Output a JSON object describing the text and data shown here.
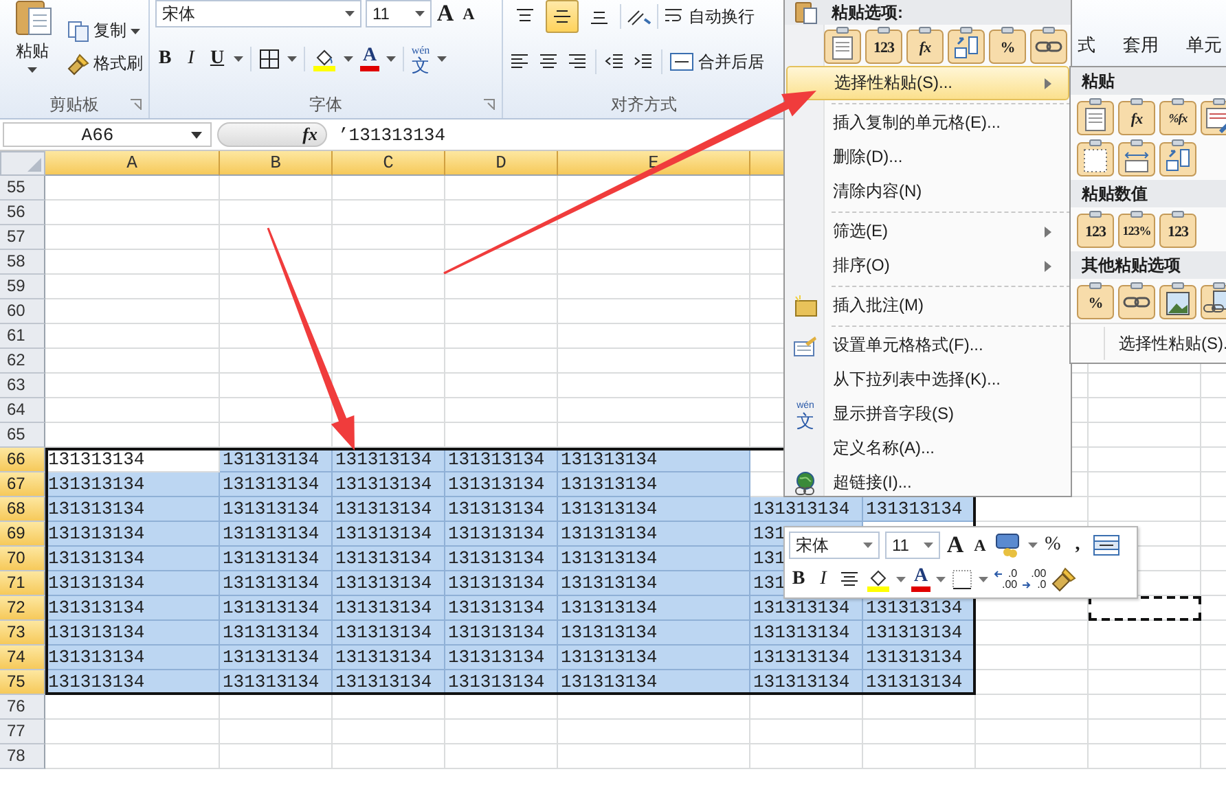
{
  "ribbon": {
    "clipboard": {
      "paste": "粘贴",
      "copy": "复制",
      "format_painter": "格式刷",
      "label": "剪贴板"
    },
    "font": {
      "name": "宋体",
      "size": "11",
      "grow": "A",
      "shrink": "A",
      "styles": [
        {
          "kind": "bold",
          "text": "B"
        },
        {
          "kind": "italic",
          "text": "I"
        },
        {
          "kind": "underline",
          "text": "U"
        }
      ],
      "font_color": "A",
      "phonetic_top": "wén",
      "phonetic_bottom": "文",
      "label": "字体"
    },
    "alignment": {
      "vertical": [
        {
          "kind": "top",
          "selected": false
        },
        {
          "kind": "middle",
          "selected": true
        },
        {
          "kind": "bottom",
          "selected": false
        }
      ],
      "wrap": "自动换行",
      "merge": "合并后居",
      "label": "对齐方式"
    },
    "styles": [
      "式",
      "套用",
      "单元"
    ]
  },
  "formula_bar": {
    "name_box": "A66",
    "fx": "fx",
    "value": "’131313134"
  },
  "sheet": {
    "columns": [
      {
        "label": "A",
        "selected": true
      },
      {
        "label": "B",
        "selected": true
      },
      {
        "label": "C",
        "selected": true
      },
      {
        "label": "D",
        "selected": true
      },
      {
        "label": "E",
        "selected": true
      },
      {
        "selected": true
      }
    ],
    "rows": [
      {
        "number": "55",
        "selected": false
      },
      {
        "number": "56",
        "selected": false
      },
      {
        "number": "57",
        "selected": false
      },
      {
        "number": "58",
        "selected": false
      },
      {
        "number": "59",
        "selected": false
      },
      {
        "number": "60",
        "selected": false
      },
      {
        "number": "61",
        "selected": false
      },
      {
        "number": "62",
        "selected": false
      },
      {
        "number": "63",
        "selected": false
      },
      {
        "number": "64",
        "selected": false
      },
      {
        "number": "65",
        "selected": false
      },
      {
        "number": "66",
        "selected": true,
        "cells": [
          {
            "text": "131313134",
            "selected": false
          },
          {
            "text": "131313134",
            "selected": true
          },
          {
            "text": "131313134",
            "selected": true
          },
          {
            "text": "131313134",
            "selected": true
          },
          {
            "text": "131313134",
            "selected": true
          }
        ]
      },
      {
        "number": "67",
        "selected": true,
        "cells": [
          {
            "text": "131313134",
            "selected": true
          },
          {
            "text": "131313134",
            "selected": true
          },
          {
            "text": "131313134",
            "selected": true
          },
          {
            "text": "131313134",
            "selected": true
          },
          {
            "text": "131313134",
            "selected": true
          }
        ]
      },
      {
        "number": "68",
        "selected": true,
        "cells": [
          {
            "text": "131313134",
            "selected": true
          },
          {
            "text": "131313134",
            "selected": true
          },
          {
            "text": "131313134",
            "selected": true
          },
          {
            "text": "131313134",
            "selected": true
          },
          {
            "text": "131313134",
            "selected": true
          },
          {
            "text": "131313134",
            "selected": true
          },
          {
            "text": "131313134",
            "selected": true
          }
        ]
      },
      {
        "number": "69",
        "selected": true,
        "cells": [
          {
            "text": "131313134",
            "selected": true
          },
          {
            "text": "131313134",
            "selected": true
          },
          {
            "text": "131313134",
            "selected": true
          },
          {
            "text": "131313134",
            "selected": true
          },
          {
            "text": "131313134",
            "selected": true
          },
          {
            "text": "131",
            "selected": true
          }
        ]
      },
      {
        "number": "70",
        "selected": true,
        "cells": [
          {
            "text": "131313134",
            "selected": true
          },
          {
            "text": "131313134",
            "selected": true
          },
          {
            "text": "131313134",
            "selected": true
          },
          {
            "text": "131313134",
            "selected": true
          },
          {
            "text": "131313134",
            "selected": true
          },
          {
            "text": "131",
            "selected": true
          }
        ]
      },
      {
        "number": "71",
        "selected": true,
        "cells": [
          {
            "text": "131313134",
            "selected": true
          },
          {
            "text": "131313134",
            "selected": true
          },
          {
            "text": "131313134",
            "selected": true
          },
          {
            "text": "131313134",
            "selected": true
          },
          {
            "text": "131313134",
            "selected": true
          },
          {
            "text": "131",
            "selected": true
          }
        ]
      },
      {
        "number": "72",
        "selected": true,
        "cells": [
          {
            "text": "131313134",
            "selected": true
          },
          {
            "text": "131313134",
            "selected": true
          },
          {
            "text": "131313134",
            "selected": true
          },
          {
            "text": "131313134",
            "selected": true
          },
          {
            "text": "131313134",
            "selected": true
          },
          {
            "text": "131313134",
            "selected": true
          },
          {
            "text": "131313134",
            "selected": true
          }
        ]
      },
      {
        "number": "73",
        "selected": true,
        "cells": [
          {
            "text": "131313134",
            "selected": true
          },
          {
            "text": "131313134",
            "selected": true
          },
          {
            "text": "131313134",
            "selected": true
          },
          {
            "text": "131313134",
            "selected": true
          },
          {
            "text": "131313134",
            "selected": true
          },
          {
            "text": "131313134",
            "selected": true
          },
          {
            "text": "131313134",
            "selected": true
          }
        ]
      },
      {
        "number": "74",
        "selected": true,
        "cells": [
          {
            "text": "131313134",
            "selected": true
          },
          {
            "text": "131313134",
            "selected": true
          },
          {
            "text": "131313134",
            "selected": true
          },
          {
            "text": "131313134",
            "selected": true
          },
          {
            "text": "131313134",
            "selected": true
          },
          {
            "text": "131313134",
            "selected": true
          },
          {
            "text": "131313134",
            "selected": true
          }
        ]
      },
      {
        "number": "75",
        "selected": true,
        "cells": [
          {
            "text": "131313134",
            "selected": true
          },
          {
            "text": "131313134",
            "selected": true
          },
          {
            "text": "131313134",
            "selected": true
          },
          {
            "text": "131313134",
            "selected": true
          },
          {
            "text": "131313134",
            "selected": true
          },
          {
            "text": "131313134",
            "selected": true
          },
          {
            "text": "131313134",
            "selected": true
          }
        ]
      },
      {
        "number": "76",
        "selected": false
      },
      {
        "number": "77",
        "selected": false
      },
      {
        "number": "78",
        "selected": false
      }
    ]
  },
  "context_menu": {
    "header": "粘贴选项:",
    "paste_options": [
      {
        "kind": "paste"
      },
      {
        "kind": "values",
        "label": "123"
      },
      {
        "kind": "formulas",
        "label": "fx"
      },
      {
        "kind": "transpose"
      },
      {
        "kind": "formatting",
        "label": "%"
      },
      {
        "kind": "link"
      }
    ],
    "sections": [
      [
        {
          "kind": "plain",
          "label": "选择性粘贴(S)...",
          "selected": true,
          "submenu": true
        }
      ],
      [
        {
          "kind": "plain",
          "label": "插入复制的单元格(E)...",
          "selected": false,
          "submenu": false
        },
        {
          "kind": "plain",
          "label": "删除(D)...",
          "selected": false,
          "submenu": false
        },
        {
          "kind": "plain",
          "label": "清除内容(N)",
          "selected": false,
          "submenu": false
        }
      ],
      [
        {
          "kind": "plain",
          "label": "筛选(E)",
          "selected": false,
          "submenu": true
        },
        {
          "kind": "plain",
          "label": "排序(O)",
          "selected": false,
          "submenu": true
        }
      ],
      [
        {
          "kind": "comment",
          "label": "插入批注(M)",
          "selected": false,
          "submenu": false
        }
      ],
      [
        {
          "kind": "format",
          "label": "设置单元格格式(F)...",
          "selected": false,
          "submenu": false
        },
        {
          "kind": "plain",
          "label": "从下拉列表中选择(K)...",
          "selected": false,
          "submenu": false
        },
        {
          "kind": "phonetic",
          "label": "显示拼音字段(S)",
          "selected": false,
          "submenu": false,
          "icon_top": "wén",
          "icon_bottom": "文"
        },
        {
          "kind": "plain",
          "label": "定义名称(A)...",
          "selected": false,
          "submenu": false
        },
        {
          "kind": "link",
          "label": "超链接(I)...",
          "selected": false,
          "submenu": false
        }
      ]
    ]
  },
  "paste_submenu": {
    "groups": [
      {
        "title": "粘贴",
        "options": [
          {
            "kind": "paste"
          },
          {
            "kind": "formulas",
            "label": "fx"
          },
          {
            "kind": "formulas_number",
            "label": "%fx"
          },
          {
            "kind": "keep_source"
          },
          {
            "kind": "no_borders"
          },
          {
            "kind": "column_widths"
          },
          {
            "kind": "transpose"
          }
        ]
      },
      {
        "title": "粘贴数值",
        "options": [
          {
            "kind": "values",
            "label": "123"
          },
          {
            "kind": "values_number",
            "label": "123%"
          },
          {
            "kind": "values_source",
            "label": "123"
          }
        ]
      },
      {
        "title": "其他粘贴选项",
        "options": [
          {
            "kind": "formatting",
            "label": "%"
          },
          {
            "kind": "link"
          },
          {
            "kind": "picture"
          },
          {
            "kind": "linked_picture"
          }
        ]
      }
    ],
    "footer": "选择性粘贴(S)."
  },
  "mini_toolbar": {
    "font": "宋体",
    "size": "11",
    "grow": "A",
    "shrink": "A",
    "percent": "%",
    "comma": ",",
    "bold": "B",
    "italic": "I",
    "font_color": "A",
    "decimals": [
      {
        "kind": "increase",
        "top": ".0",
        "bottom": ".00"
      },
      {
        "kind": "decrease",
        "top": ".00",
        "bottom": ".0"
      }
    ]
  }
}
